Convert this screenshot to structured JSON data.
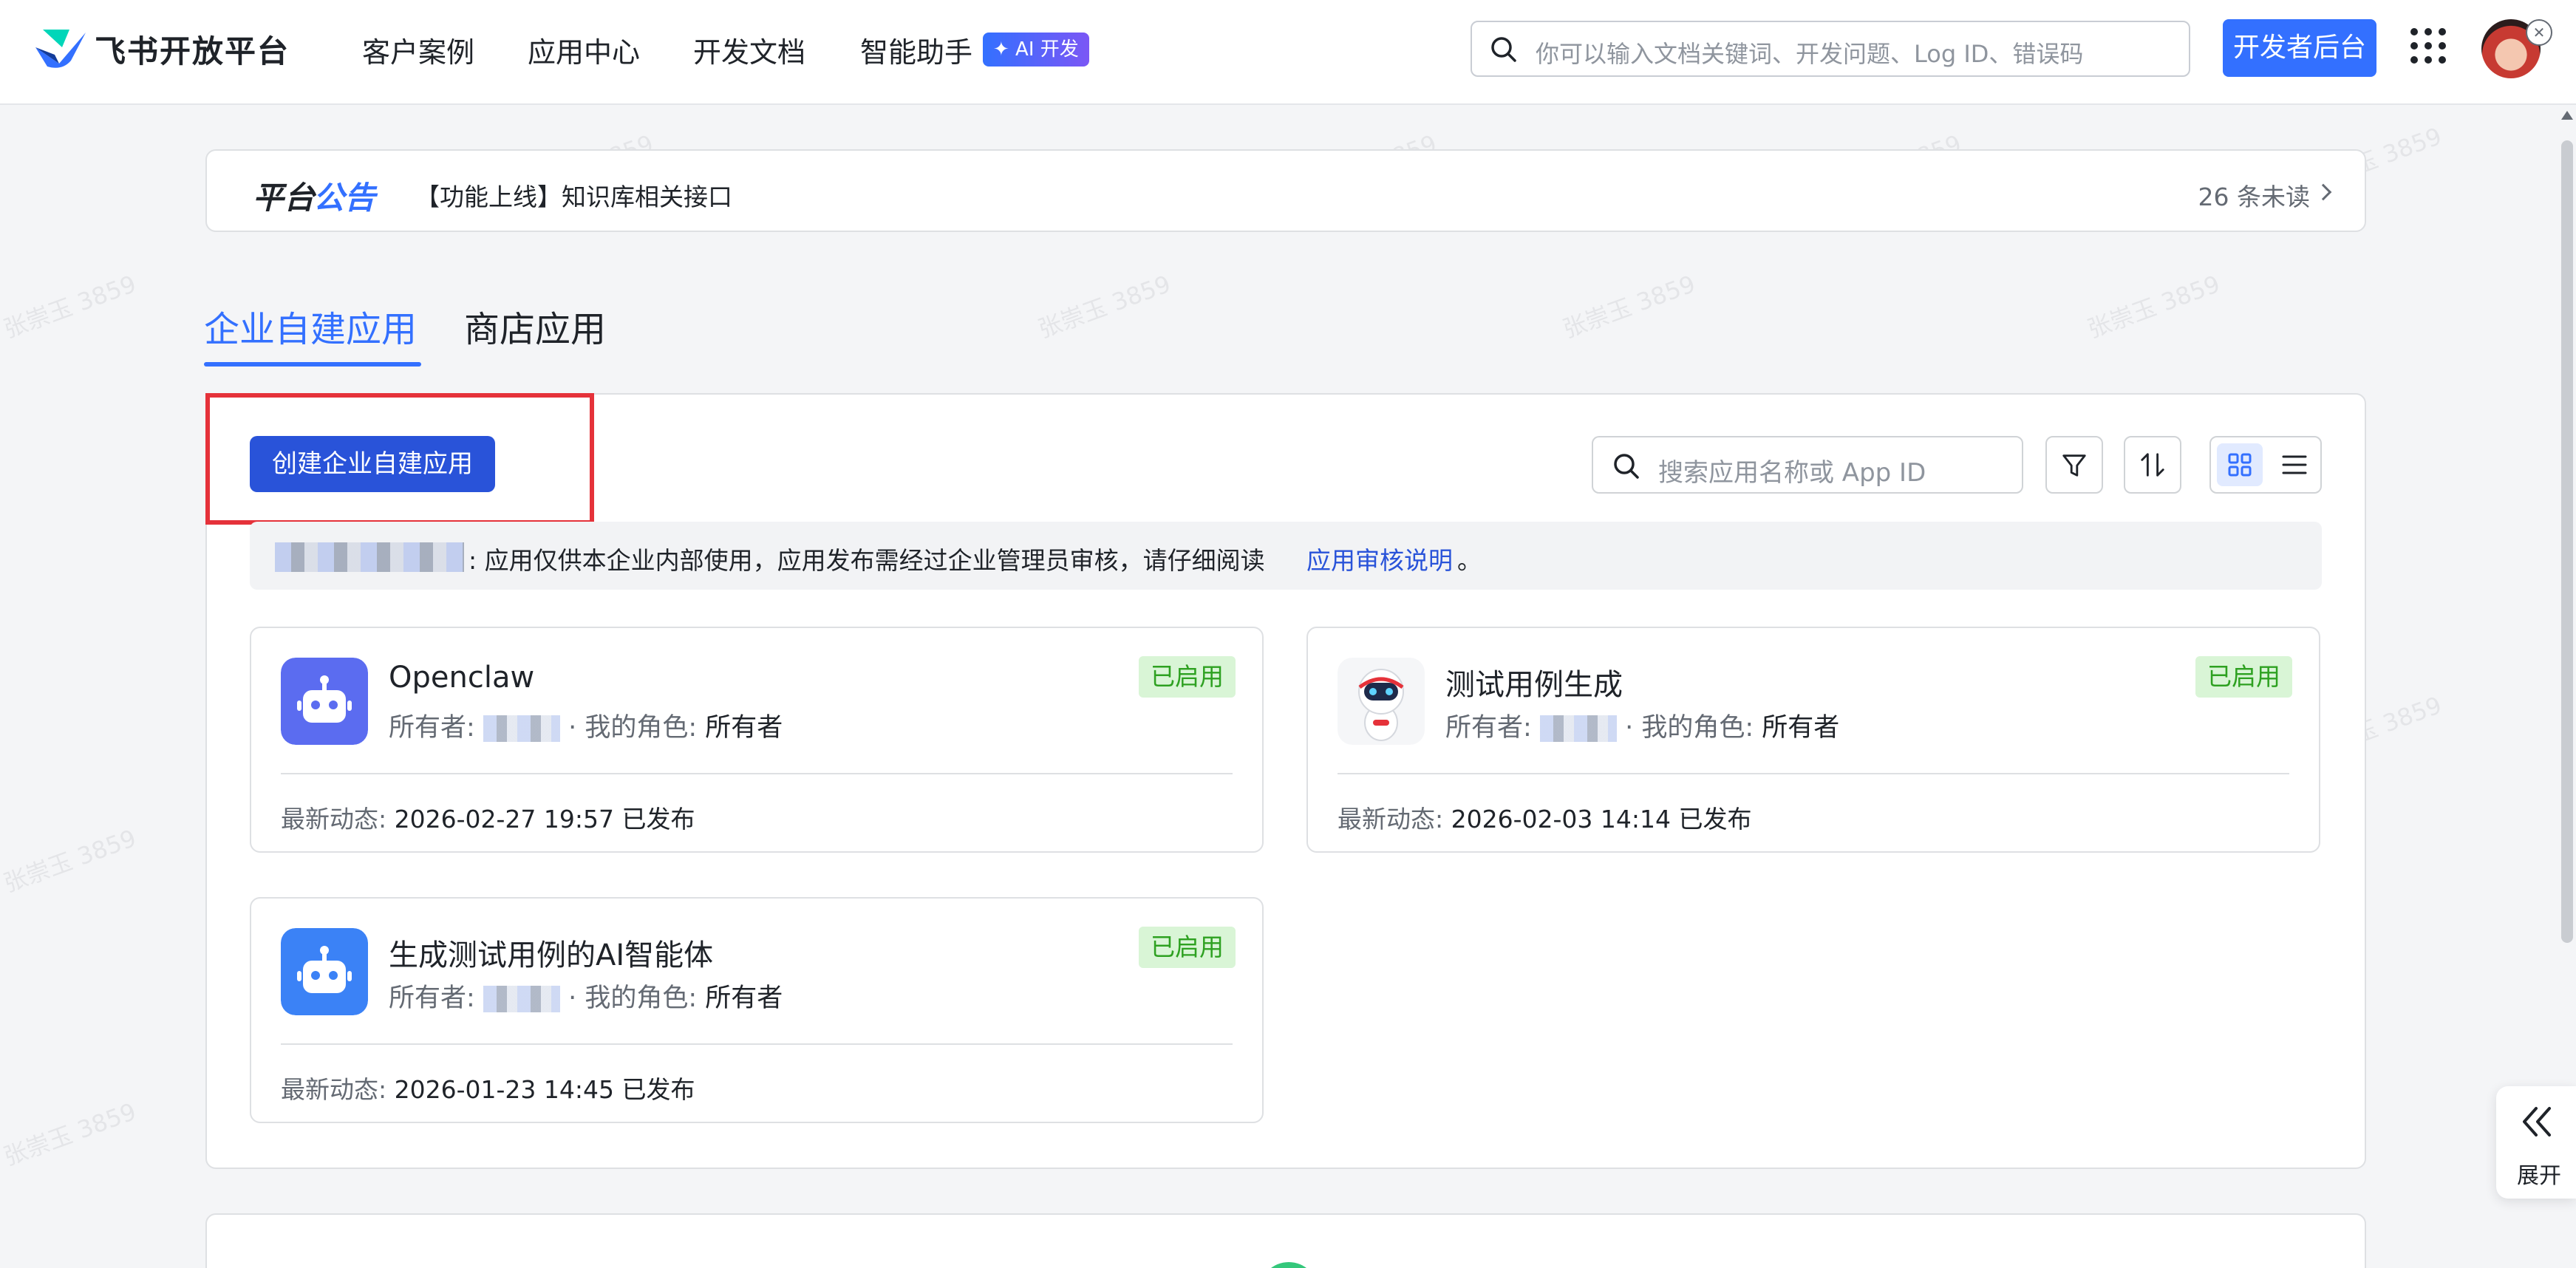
{
  "header": {
    "brand": "飞书开放平台",
    "nav": [
      "客户案例",
      "应用中心",
      "开发文档",
      "智能助手"
    ],
    "ai_badge": "✦ AI 开发",
    "search_placeholder": "你可以输入文档关键词、开发问题、Log ID、错误码",
    "console_button": "开发者后台",
    "close_glyph": "✕"
  },
  "announcement": {
    "title_part1": "平台",
    "title_part2": "公告",
    "text": "【功能上线】知识库相关接口",
    "unread": "26 条未读"
  },
  "tabs": [
    "企业自建应用",
    "商店应用"
  ],
  "toolbar": {
    "create_button": "创建企业自建应用",
    "search_placeholder": "搜索应用名称或 App ID"
  },
  "notice": {
    "text": ": 应用仅供本企业内部使用，应用发布需经过企业管理员审核，请仔细阅读 ",
    "link": "应用审核说明",
    "end": "。"
  },
  "labels": {
    "owner": "所有者:",
    "role": "我的角色:",
    "latest": "最新动态:",
    "sep": "·"
  },
  "apps": [
    {
      "name": "Openclaw",
      "status": "已启用",
      "role": "所有者",
      "latest": "2026-02-27 19:57 已发布"
    },
    {
      "name": "测试用例生成",
      "status": "已启用",
      "role": "所有者",
      "latest": "2026-02-03 14:14 已发布"
    },
    {
      "name": "生成测试用例的AI智能体",
      "status": "已启用",
      "role": "所有者",
      "latest": "2026-01-23 14:45 已发布"
    }
  ],
  "side_expand": "展开",
  "watermark": "张崇玉 3859",
  "colors": {
    "accent": "#3370ff",
    "primary_button": "#2953d9",
    "status_green": "#2ea121",
    "status_bg": "#d9f5d6",
    "highlight_red": "#e5323a"
  }
}
